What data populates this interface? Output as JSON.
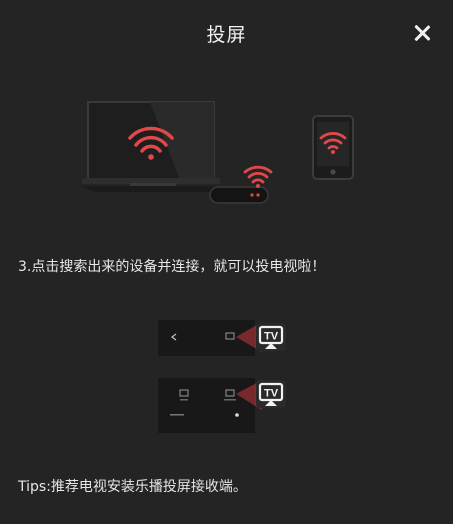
{
  "dialog": {
    "title": "投屏",
    "close_icon": "close-icon"
  },
  "illustration": {
    "devices": [
      "tv-icon",
      "tv-box-icon",
      "phone-icon"
    ],
    "signal_icon": "wifi-signal-icon",
    "accent_color": "#e0484a"
  },
  "instruction": {
    "step_text": "3.点击搜索出来的设备并连接，就可以投电视啦！"
  },
  "demo_screens": [
    {
      "cast_icon": "tv-cast-icon",
      "back_icon": "back-chevron-icon"
    },
    {
      "cast_icon": "tv-cast-icon"
    }
  ],
  "tips": {
    "text": "Tips:推荐电视安装乐播投屏接收端。"
  }
}
